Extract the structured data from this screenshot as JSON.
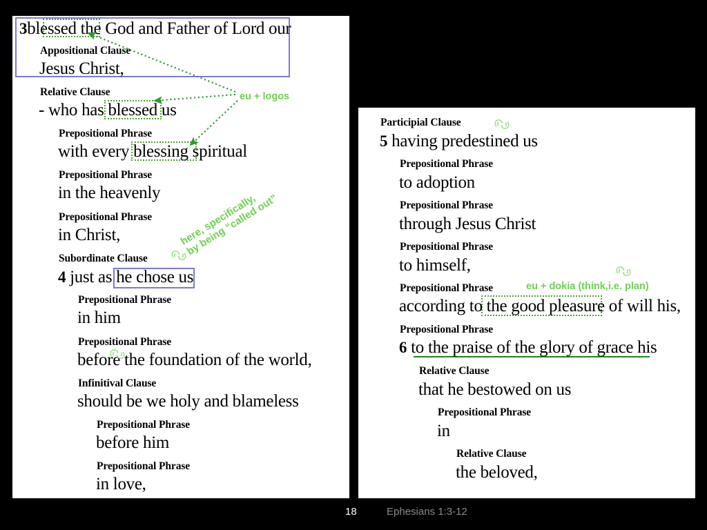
{
  "slide": {
    "page_number": "18",
    "title": "Ephesians 1:3-12",
    "background_color": "#000000",
    "accent_purple": "#7b78db",
    "accent_green": "#6ed152",
    "annotation_green": "#4aa02c"
  },
  "left_panel": {
    "lines": [
      {
        "type": "text",
        "verse": "3",
        "content": "blessed the God and Father of Lord our"
      },
      {
        "type": "label",
        "content": "Appositional Clause"
      },
      {
        "type": "text",
        "content": "Jesus Christ,"
      },
      {
        "type": "label",
        "content": "Relative Clause"
      },
      {
        "type": "text",
        "content": "- who has blessed us"
      },
      {
        "type": "label",
        "content": "Prepositional Phrase"
      },
      {
        "type": "text",
        "content": "with every blessing spiritual"
      },
      {
        "type": "label",
        "content": "Prepositional Phrase"
      },
      {
        "type": "text",
        "content": "in the heavenly"
      },
      {
        "type": "label",
        "content": "Prepositional Phrase"
      },
      {
        "type": "text",
        "content": "in Christ,"
      },
      {
        "type": "label",
        "content": "Subordinate Clause"
      },
      {
        "type": "text",
        "verse": "4",
        "content": "just as he chose us"
      },
      {
        "type": "label",
        "content": "Prepositional Phrase"
      },
      {
        "type": "text",
        "content": "in him"
      },
      {
        "type": "label",
        "content": "Prepositional Phrase"
      },
      {
        "type": "text",
        "content": "before the foundation of the world,"
      },
      {
        "type": "label",
        "content": "Infinitival Clause"
      },
      {
        "type": "text",
        "content": "should be we holy and blameless"
      },
      {
        "type": "label",
        "content": "Prepositional Phrase"
      },
      {
        "type": "text",
        "content": "before him"
      },
      {
        "type": "label",
        "content": "Prepositional Phrase"
      },
      {
        "type": "text",
        "content": "in love,"
      }
    ],
    "annotations": {
      "eu_logos": "eu + logos",
      "called_out_line1": "here, specifically,",
      "called_out_line2": "by being “called out”"
    }
  },
  "right_panel": {
    "lines": [
      {
        "type": "label",
        "content": "Participial Clause"
      },
      {
        "type": "text",
        "verse": "5",
        "content": "having predestined us"
      },
      {
        "type": "label",
        "content": "Prepositional Phrase"
      },
      {
        "type": "text",
        "content": "to adoption"
      },
      {
        "type": "label",
        "content": "Prepositional Phrase"
      },
      {
        "type": "text",
        "content": "through Jesus Christ"
      },
      {
        "type": "label",
        "content": "Prepositional Phrase"
      },
      {
        "type": "text",
        "content": "to himself,"
      },
      {
        "type": "label",
        "content": "Prepositional Phrase"
      },
      {
        "type": "text",
        "content": "according to the good pleasure of will his,"
      },
      {
        "type": "label",
        "content": "Prepositional Phrase"
      },
      {
        "type": "text",
        "verse": "6",
        "content": "to the praise of the glory of grace his"
      },
      {
        "type": "label",
        "content": "Relative Clause"
      },
      {
        "type": "text",
        "content": "that he bestowed on us"
      },
      {
        "type": "label",
        "content": "Prepositional Phrase"
      },
      {
        "type": "text",
        "content": "in"
      },
      {
        "type": "label",
        "content": "Relative Clause"
      },
      {
        "type": "text",
        "content": "the beloved,"
      }
    ],
    "annotations": {
      "eu_dokia": "eu + dokia (think,i.e. plan)"
    }
  }
}
